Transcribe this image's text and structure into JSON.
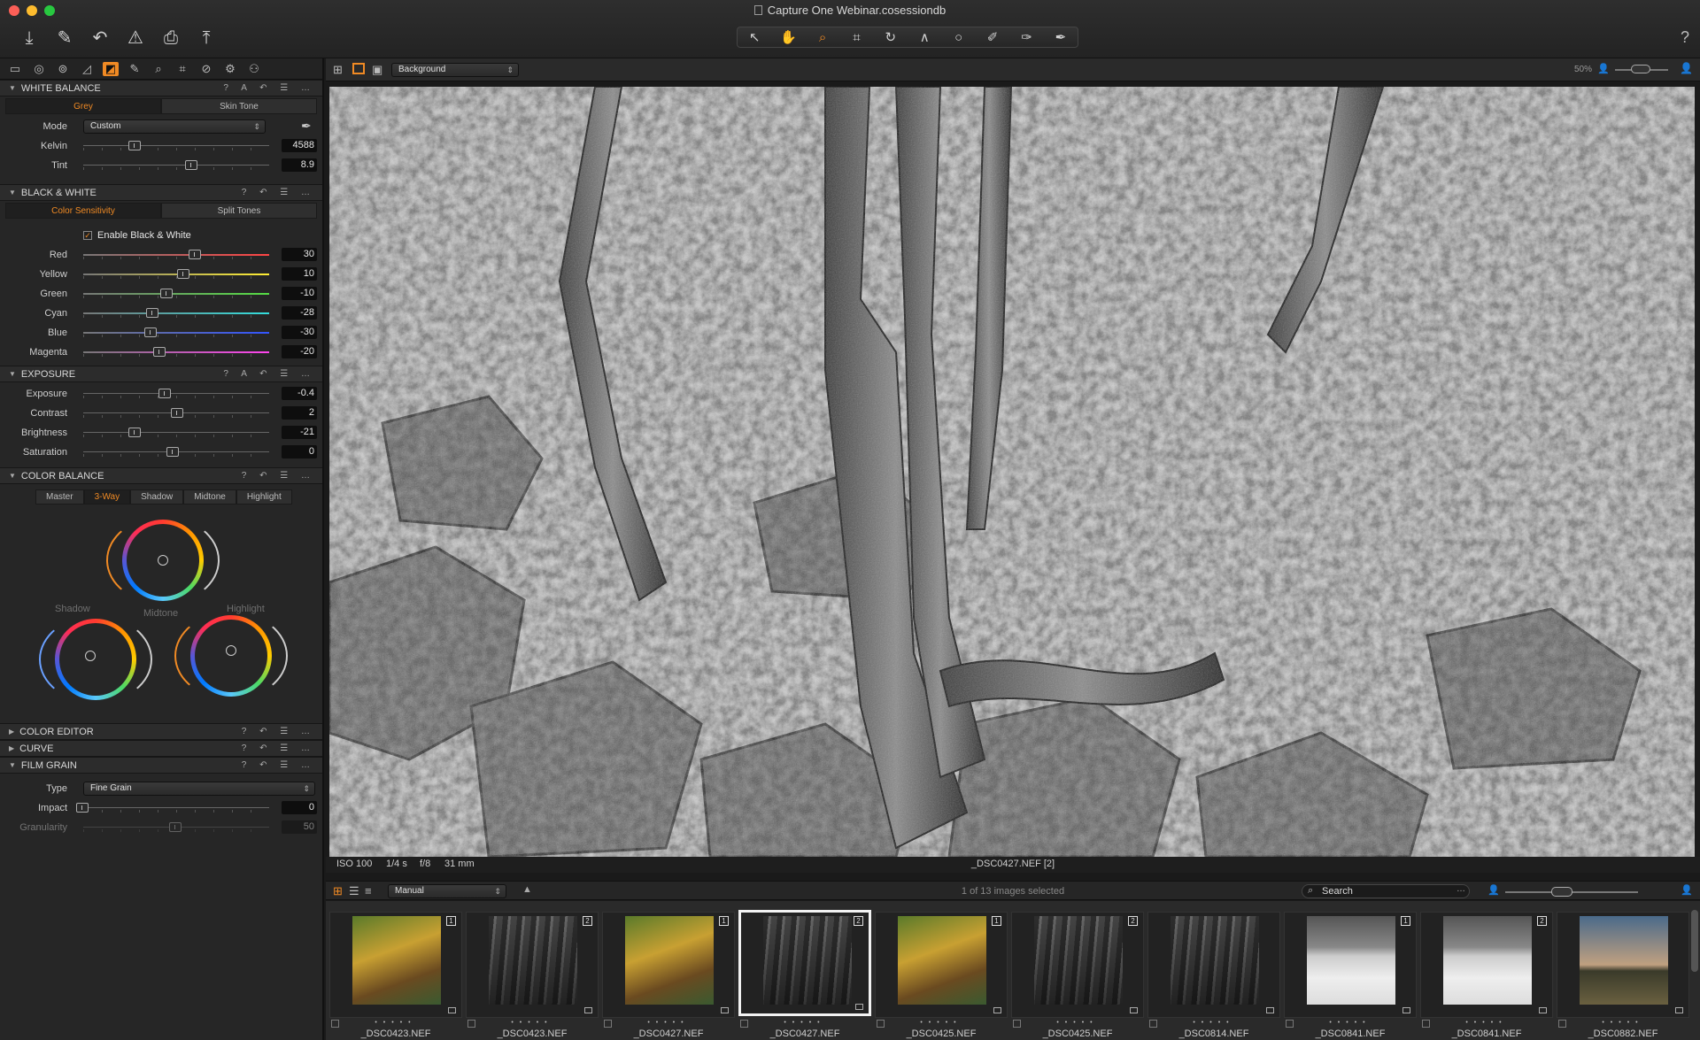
{
  "window": {
    "title": "Capture One Webinar.cosessiondb"
  },
  "toolbar": {
    "left_icons": [
      "import-icon",
      "brush-icon",
      "undo-icon",
      "warning-icon",
      "print-icon",
      "export-icon"
    ],
    "cursor_tools": [
      "select-cursor",
      "pan-hand",
      "zoom",
      "crop",
      "rotate",
      "keystone",
      "spot-removal",
      "draw-mask",
      "erase-mask",
      "picker"
    ],
    "help": "?"
  },
  "tool_tabs": [
    "library",
    "capture",
    "lens",
    "color",
    "exposure",
    "details",
    "local-adjust",
    "crop-tab",
    "metadata",
    "output",
    "settings"
  ],
  "white_balance": {
    "title": "WHITE BALANCE",
    "tabs": [
      "Grey",
      "Skin Tone"
    ],
    "mode_label": "Mode",
    "mode_value": "Custom",
    "kelvin_label": "Kelvin",
    "kelvin_value": "4588",
    "tint_label": "Tint",
    "tint_value": "8.9"
  },
  "black_white": {
    "title": "BLACK & WHITE",
    "tabs": [
      "Color Sensitivity",
      "Split Tones"
    ],
    "enable_label": "Enable Black & White",
    "channels": [
      {
        "label": "Red",
        "value": "30"
      },
      {
        "label": "Yellow",
        "value": "10"
      },
      {
        "label": "Green",
        "value": "-10"
      },
      {
        "label": "Cyan",
        "value": "-28"
      },
      {
        "label": "Blue",
        "value": "-30"
      },
      {
        "label": "Magenta",
        "value": "-20"
      }
    ]
  },
  "exposure": {
    "title": "EXPOSURE",
    "rows": [
      {
        "label": "Exposure",
        "value": "-0.4"
      },
      {
        "label": "Contrast",
        "value": "2"
      },
      {
        "label": "Brightness",
        "value": "-21"
      },
      {
        "label": "Saturation",
        "value": "0"
      }
    ]
  },
  "color_balance": {
    "title": "COLOR BALANCE",
    "tabs": [
      "Master",
      "3-Way",
      "Shadow",
      "Midtone",
      "Highlight"
    ],
    "wheel_labels": [
      "Shadow",
      "Midtone",
      "Highlight"
    ]
  },
  "collapsed_sections": [
    "COLOR EDITOR",
    "CURVE"
  ],
  "film_grain": {
    "title": "FILM GRAIN",
    "type_label": "Type",
    "type_value": "Fine Grain",
    "impact_label": "Impact",
    "impact_value": "0",
    "granularity_label": "Granularity",
    "granularity_value": "50"
  },
  "viewer": {
    "background_select": "Background",
    "zoom": "50%",
    "info": {
      "iso": "ISO 100",
      "shutter": "1/4 s",
      "aperture": "f/8",
      "focal": "31 mm"
    },
    "filename": "_DSC0427.NEF [2]"
  },
  "browser": {
    "sort": "Manual",
    "selection_status": "1 of 13 images selected",
    "search_placeholder": "Search",
    "thumbnails": [
      {
        "variant": "1",
        "style": "color",
        "caption": "_DSC0423.NEF"
      },
      {
        "variant": "2",
        "style": "bw",
        "caption": "_DSC0423.NEF"
      },
      {
        "variant": "1",
        "style": "color",
        "caption": "_DSC0427.NEF"
      },
      {
        "variant": "2",
        "style": "bw",
        "caption": "_DSC0427.NEF"
      },
      {
        "variant": "1",
        "style": "color",
        "caption": "_DSC0425.NEF"
      },
      {
        "variant": "2",
        "style": "bw",
        "caption": "_DSC0425.NEF"
      },
      {
        "variant": "",
        "style": "bw",
        "caption": "_DSC0814.NEF"
      },
      {
        "variant": "1",
        "style": "snow",
        "caption": "_DSC0841.NEF"
      },
      {
        "variant": "2",
        "style": "snow",
        "caption": "_DSC0841.NEF"
      },
      {
        "variant": "",
        "style": "sky",
        "caption": "_DSC0882.NEF"
      }
    ],
    "selected_index": 3
  },
  "colors": {
    "accent": "#f08a24",
    "panel": "#262626",
    "window": "#1a1a1a"
  }
}
